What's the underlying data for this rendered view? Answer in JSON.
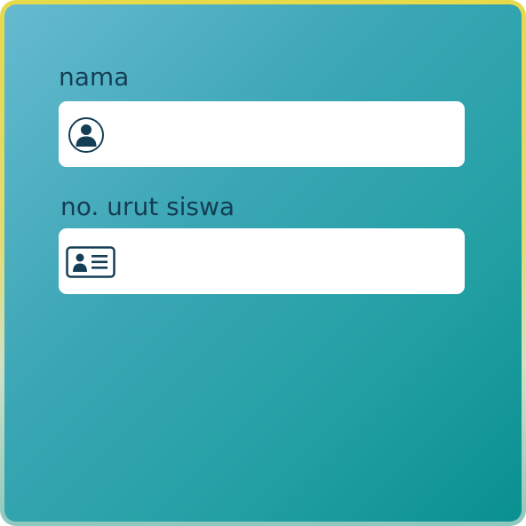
{
  "form": {
    "name_field": {
      "label": "nama",
      "value": "",
      "placeholder": "",
      "icon": "user-circle-icon"
    },
    "student_number_field": {
      "label": "no. urut siswa",
      "value": "",
      "placeholder": "",
      "icon": "id-card-icon"
    }
  },
  "colors": {
    "frame_top": "#e6d94a",
    "frame_bottom": "#8fc8be",
    "panel_start": "#66bad0",
    "panel_end": "#0a9090",
    "text": "#143e55",
    "field_background": "#ffffff"
  }
}
